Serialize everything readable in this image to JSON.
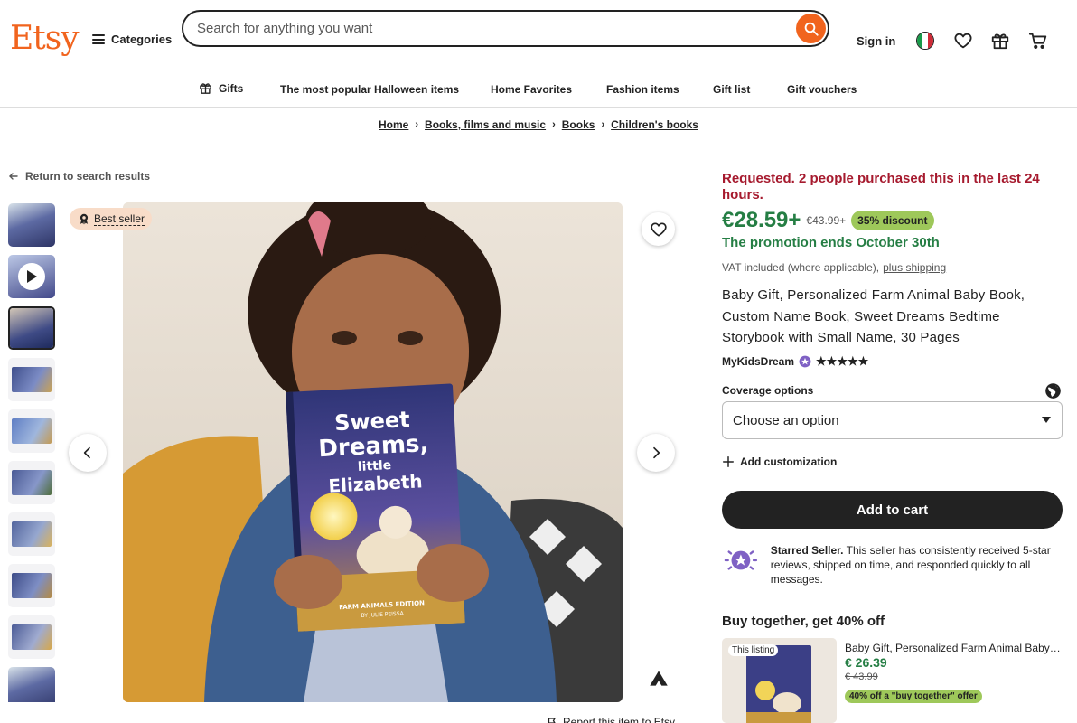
{
  "header": {
    "logo": "Etsy",
    "categories_label": "Categories",
    "search_placeholder": "Search for anything you want",
    "signin_label": "Sign in"
  },
  "nav": {
    "items": [
      "Gifts",
      "The most popular Halloween items",
      "Home Favorites",
      "Fashion items",
      "Gift list",
      "Gift vouchers"
    ]
  },
  "breadcrumb": [
    "Home",
    "Books, films and music",
    "Books",
    "Children's books"
  ],
  "back_label": "Return to search results",
  "gallery": {
    "best_seller_label": "Best seller",
    "book_cover": {
      "title_line1": "Sweet",
      "title_line2": "Dreams,",
      "title_line3": "little",
      "title_line4": "Elizabeth",
      "edition": "FARM ANIMALS EDITION",
      "author": "BY JULIE PEISSA"
    },
    "report_label": "Report this item to Etsy"
  },
  "listing": {
    "demand_text": "Requested. 2 people purchased this in the last 24 hours.",
    "price": "€28.59+",
    "old_price": "€43.99+",
    "discount": "35% discount",
    "promo_end": "The promotion ends October 30th",
    "vat_text": "VAT included (where applicable),",
    "shipping_link": "plus shipping",
    "title": "Baby Gift, Personalized Farm Animal Baby Book, Custom Name Book, Sweet Dreams Bedtime Storybook with Small Name, 30 Pages",
    "seller_name": "MyKidsDream",
    "rating_stars": "★★★★★",
    "coverage_label": "Coverage options",
    "coverage_value": "Choose an option",
    "customization_label": "Add customization",
    "add_to_cart": "Add to cart",
    "starred_title": "Starred Seller.",
    "starred_text": "This seller has consistently received 5-star reviews, shipped on time, and responded quickly to all messages."
  },
  "bundle": {
    "heading": "Buy together, get 40% off",
    "this_listing_tag": "This listing",
    "item_name": "Baby Gift, Personalized Farm Animal Baby Book",
    "price": "€ 26.39",
    "old_price": "€ 43.99",
    "offer": "40% off a \"buy together\" offer"
  },
  "colors": {
    "brand": "#F1641E",
    "price_green": "#257E44",
    "demand_red": "#A61A2E",
    "discount_badge": "#9EC85A"
  }
}
